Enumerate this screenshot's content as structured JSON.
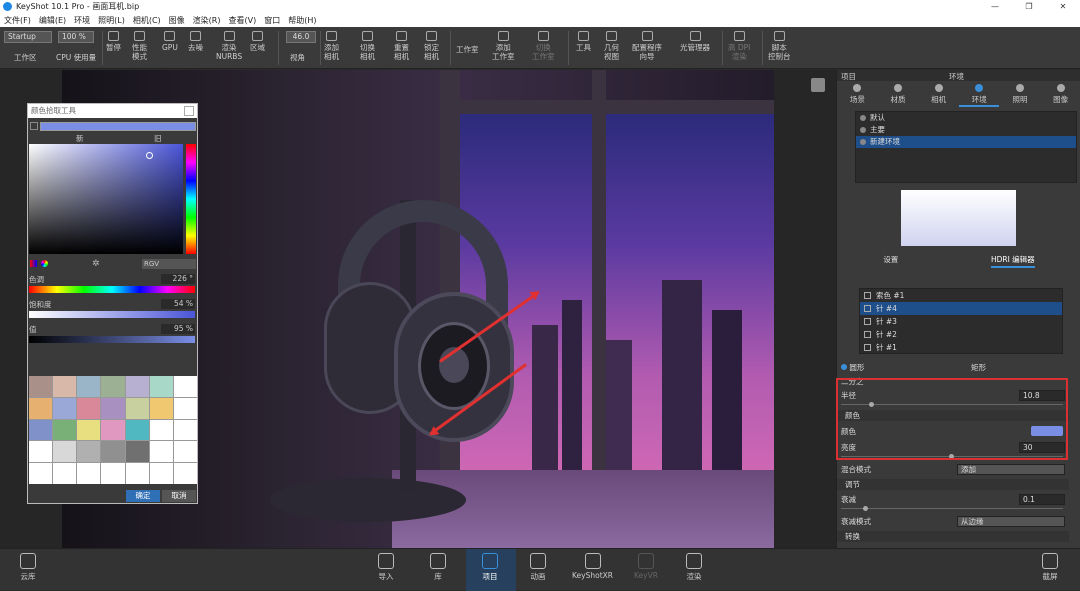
{
  "window": {
    "title": "KeyShot 10.1 Pro - 画面耳机.bip",
    "buttons": [
      "—",
      "❐",
      "✕"
    ]
  },
  "menu": [
    "文件(F)",
    "编辑(E)",
    "环境",
    "照明(L)",
    "相机(C)",
    "图像",
    "渲染(R)",
    "查看(V)",
    "窗口",
    "帮助(H)"
  ],
  "toolbar": {
    "workspace_select": "Startup",
    "workspace_label": "工作区",
    "cpu_percent": "100 %",
    "cpu_label": "CPU 使用量",
    "fov_value": "46.0",
    "items": [
      "暂停",
      "性能\n模式",
      "GPU",
      "去噪",
      "渲染\nNURBS",
      "区域",
      "视角",
      "添加\n相机",
      "切换\n相机",
      "重置\n相机",
      "锁定\n相机",
      "工作室",
      "添加\n工作室",
      "切换\n工作室",
      "工具",
      "几何\n视图",
      "配置程序\n向导",
      "光管理器",
      "高 DPI\n渲染",
      "脚本\n控制台"
    ]
  },
  "color_picker": {
    "title": "颜色拾取工具",
    "new_label": "新",
    "old_label": "旧",
    "current_color": "#7a8ee6",
    "mode": "RGV",
    "hue_label": "色调",
    "hue_value": "226 °",
    "saturation_label": "饱和度",
    "saturation_value": "54 %",
    "value_label": "值",
    "value_value": "95 %",
    "swatches": [
      "#a9918a",
      "#d8b8a8",
      "#9ab4c8",
      "#9cb094",
      "#b8b0d0",
      "#a8d8c8",
      "#fff",
      "#e6b070",
      "#9aa8d8",
      "#d88898",
      "#a890c0",
      "#c8d0a0",
      "#f0c870",
      "#fff",
      "#8090c8",
      "#78b078",
      "#e8e080",
      "#e098c0",
      "#50b8c0",
      "#fff",
      "#fff",
      "#fff",
      "#d8d8d8",
      "#b0b0b0",
      "#909090",
      "#707070",
      "#fff",
      "#fff",
      "#fff",
      "#fff",
      "#fff",
      "#fff",
      "#fff",
      "#fff",
      "#fff"
    ],
    "ok_button": "确定",
    "cancel_button": "取消"
  },
  "panel": {
    "header_left": "项目",
    "header_center": "环境",
    "tabs": [
      "场景",
      "材质",
      "相机",
      "环境",
      "照明",
      "图像"
    ],
    "active_tab": "环境",
    "environments": [
      "默认",
      "主要",
      "新建环境"
    ],
    "subtabs": [
      "设置",
      "HDRI 编辑器"
    ],
    "pins": [
      "索色 #1",
      "针 #4",
      "针 #3",
      "针 #2",
      "针 #1"
    ],
    "shape_circle": "圆形",
    "shape_rect": "矩形",
    "falloff_label": "二分之",
    "radius_label": "半径",
    "radius_value": "10.8",
    "color_section": "颜色",
    "color_label": "颜色",
    "color_swatch": "#7a8ee6",
    "brightness_label": "亮度",
    "brightness_value": "30",
    "blend_label": "混合模式",
    "blend_value": "添加",
    "adjust_section": "调节",
    "falloff2_label": "衰减",
    "falloff2_value": "0.1",
    "falloff_mode_label": "衰减模式",
    "falloff_mode_value": "从边缘",
    "transform_section": "转换"
  },
  "bottombar": {
    "cloud": "云库",
    "import": "导入",
    "library": "库",
    "project": "项目",
    "animation": "动画",
    "keyshotxr": "KeyShotXR",
    "keyvr": "KeyVR",
    "render": "渲染",
    "screenshot": "截屏"
  }
}
